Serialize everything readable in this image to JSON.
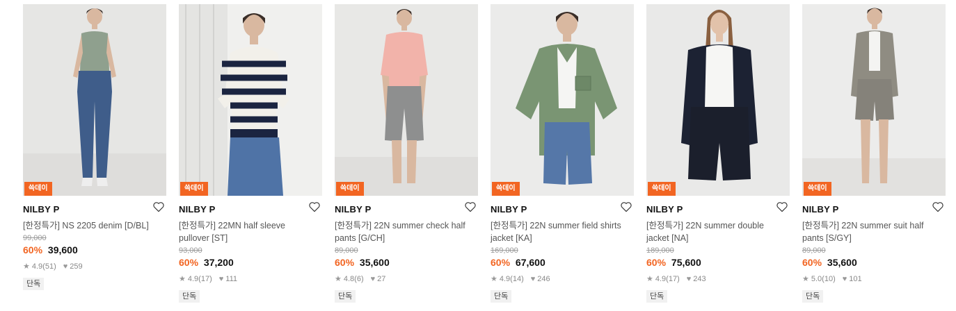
{
  "badge_label": "쓱데이",
  "tag_label": "단독",
  "colors": {
    "accent": "#f26522",
    "badge_text": "#ffffff"
  },
  "icons": {
    "wishlist": "heart-outline-icon",
    "rating": "star-icon",
    "likes": "heart-filled-icon"
  },
  "products": [
    {
      "brand": "NILBY P",
      "title": "[한정특가] NS 2205 denim [D/BL]",
      "original_price": "99,000",
      "discount": "60%",
      "sale_price": "39,600",
      "rating": "4.9",
      "reviews": "(51)",
      "likes": "259"
    },
    {
      "brand": "NILBY P",
      "title": "[한정특가] 22MN half sleeve pullover [ST]",
      "original_price": "93,000",
      "discount": "60%",
      "sale_price": "37,200",
      "rating": "4.9",
      "reviews": "(17)",
      "likes": "111"
    },
    {
      "brand": "NILBY P",
      "title": "[한정특가] 22N summer check half pants [G/CH]",
      "original_price": "89,000",
      "discount": "60%",
      "sale_price": "35,600",
      "rating": "4.8",
      "reviews": "(6)",
      "likes": "27"
    },
    {
      "brand": "NILBY P",
      "title": "[한정특가] 22N summer field shirts jacket [KA]",
      "original_price": "169,000",
      "discount": "60%",
      "sale_price": "67,600",
      "rating": "4.9",
      "reviews": "(14)",
      "likes": "246"
    },
    {
      "brand": "NILBY P",
      "title": "[한정특가] 22N summer double jacket [NA]",
      "original_price": "189,000",
      "discount": "60%",
      "sale_price": "75,600",
      "rating": "4.9",
      "reviews": "(17)",
      "likes": "243"
    },
    {
      "brand": "NILBY P",
      "title": "[한정특가] 22N summer suit half pants [S/GY]",
      "original_price": "89,000",
      "discount": "60%",
      "sale_price": "35,600",
      "rating": "5.0",
      "reviews": "(10)",
      "likes": "101"
    }
  ]
}
